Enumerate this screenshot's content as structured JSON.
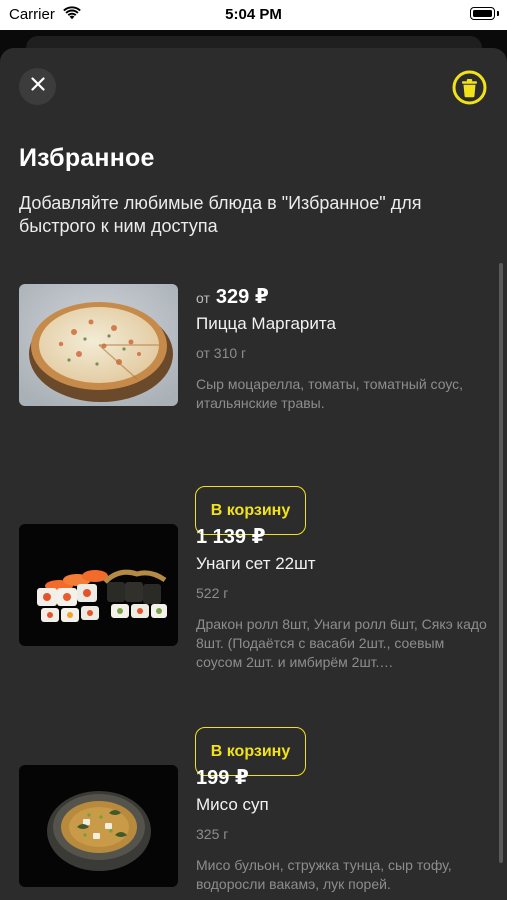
{
  "status_bar": {
    "carrier": "Carrier",
    "time": "5:04 PM"
  },
  "header": {
    "title": "Избранное",
    "subtitle": "Добавляйте любимые блюда в \"Избранное\" для быстрого к ним доступа"
  },
  "products": [
    {
      "price_prefix": "от",
      "price": "329 ₽",
      "name": "Пицца Маргарита",
      "weight": "от 310 г",
      "description": "Сыр моцарелла, томаты, томатный соус, итальянские травы.",
      "button": "В корзину"
    },
    {
      "price": "1 139 ₽",
      "name": "Унаги сет 22шт",
      "weight": "522 г",
      "description": "Дракон ролл 8шт, Унаги ролл 6шт, Сякэ кадо 8шт. (Подаётся с васаби 2шт., соевым соусом 2шт. и имбирём 2шт.…",
      "button": "В корзину"
    },
    {
      "price": "199 ₽",
      "name": "Мисо суп",
      "weight": "325 г",
      "description": "Мисо бульон, стружка тунца, сыр тофу, водоросли вакамэ, лук порей."
    }
  ],
  "colors": {
    "accent": "#f2e21a",
    "sheet": "#2c2c2c",
    "muted_text": "#8d8d8d"
  },
  "icons": {
    "close": "close-icon",
    "trash": "trash-icon",
    "wifi": "wifi-icon",
    "battery": "battery-icon"
  }
}
